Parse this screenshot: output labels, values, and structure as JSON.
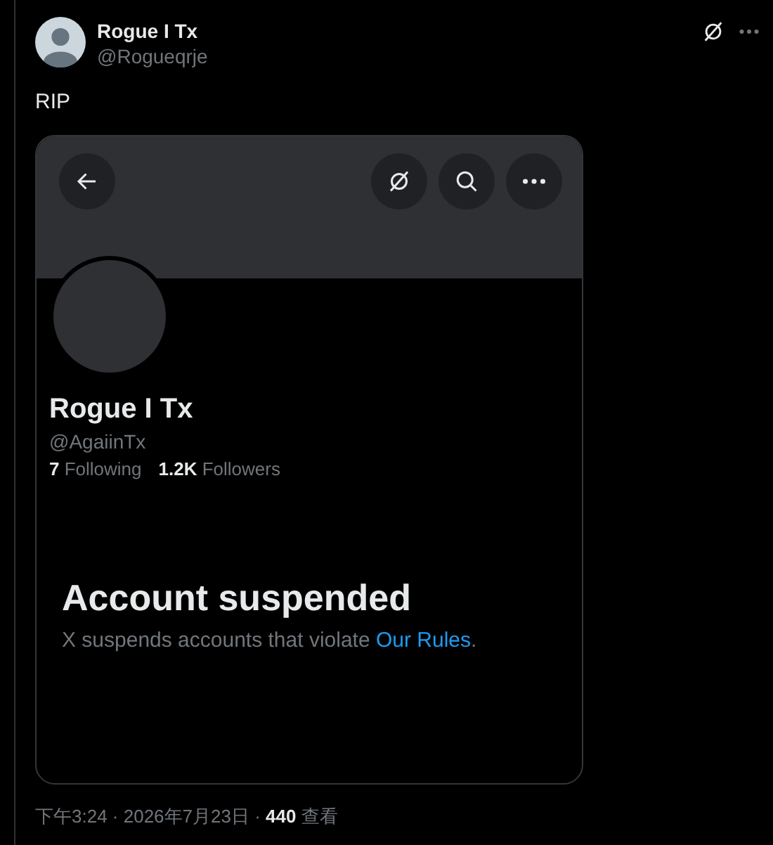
{
  "post": {
    "author": {
      "name": "Rogue I Tx",
      "handle": "@Rogueqrje"
    },
    "text": "RIP",
    "screenshot": {
      "profile": {
        "name": "Rogue I Tx",
        "handle": "@AgaiinTx",
        "stats": [
          {
            "text": "**7** Following"
          },
          {
            "text": "**1.2K** Followers"
          }
        ]
      },
      "notice": {
        "title": "Account suspended",
        "body": "X suspends accounts that violate",
        "link": "Our Rules",
        "after": "."
      }
    },
    "meta": "下午3:24 · 2026年7月23日 · **440** 查看"
  }
}
